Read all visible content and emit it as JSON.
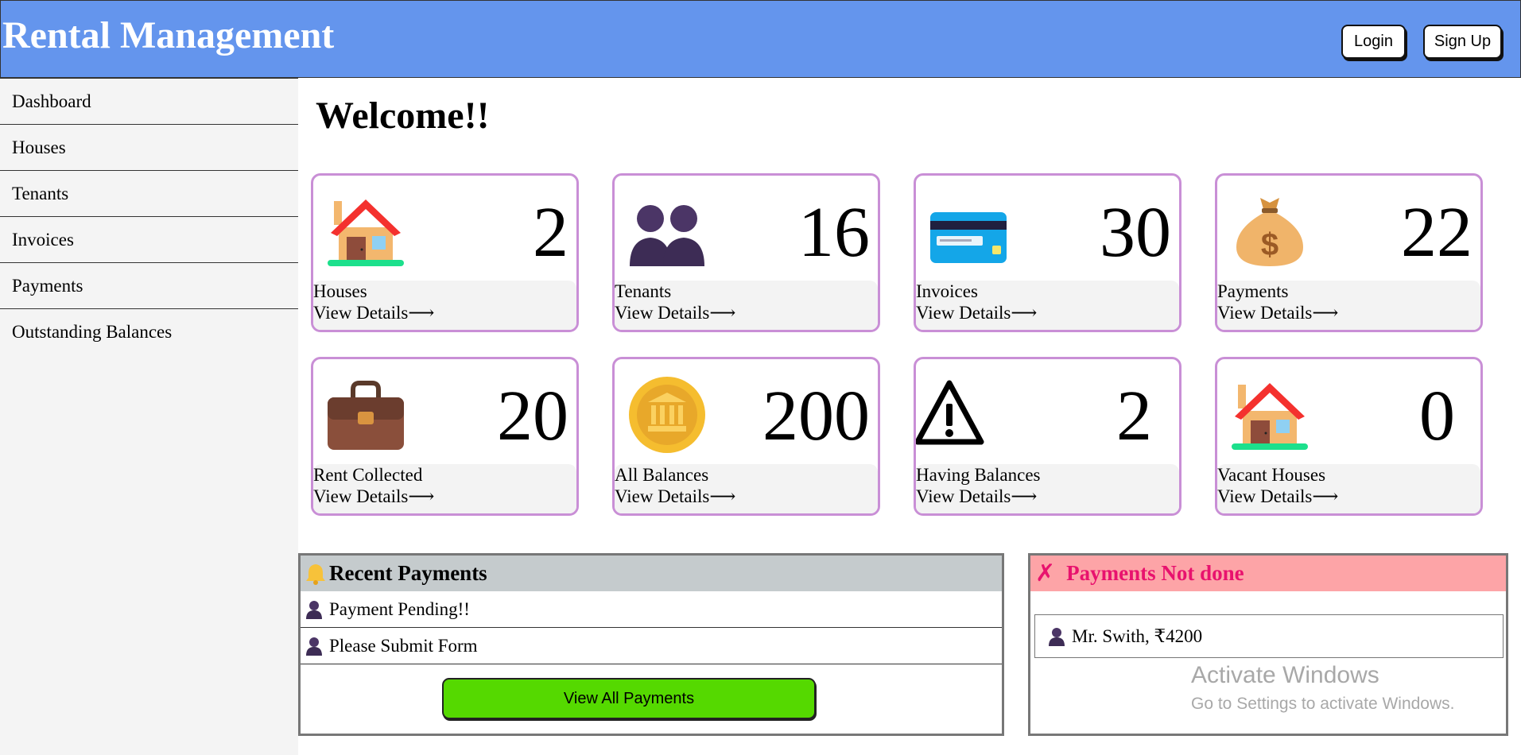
{
  "header": {
    "title": "Rental Management",
    "login_label": "Login",
    "signup_label": "Sign Up",
    "color": "#6495ed"
  },
  "sidebar": {
    "items": [
      {
        "label": "Dashboard"
      },
      {
        "label": "Houses"
      },
      {
        "label": "Tenants"
      },
      {
        "label": "Invoices"
      },
      {
        "label": "Payments"
      },
      {
        "label": "Outstanding Balances"
      }
    ]
  },
  "main": {
    "welcome": "Welcome!!",
    "cards": [
      {
        "label": "Houses",
        "count": "2",
        "link": "View Details⟶",
        "icon": "house-icon"
      },
      {
        "label": "Tenants",
        "count": "16",
        "link": "View Details⟶",
        "icon": "people-icon"
      },
      {
        "label": "Invoices",
        "count": "30",
        "link": "View Details⟶",
        "icon": "credit-card-icon"
      },
      {
        "label": "Payments",
        "count": "22",
        "link": "View Details⟶",
        "icon": "money-bag-icon"
      },
      {
        "label": "Rent Collected",
        "count": "20",
        "link": "View Details⟶",
        "icon": "briefcase-icon"
      },
      {
        "label": "All Balances",
        "count": "200",
        "link": "View Details⟶",
        "icon": "bank-coin-icon"
      },
      {
        "label": "Having Balances",
        "count": "2",
        "link": "View Details⟶",
        "icon": "warning-icon"
      },
      {
        "label": "Vacant Houses",
        "count": "0",
        "link": "View Details⟶",
        "icon": "house-icon"
      }
    ]
  },
  "recent_payments": {
    "title": "Recent Payments",
    "icon": "bell-icon",
    "rows": [
      "Payment Pending!!",
      "Please Submit Form"
    ],
    "button_label": "View All Payments"
  },
  "payments_not_done": {
    "title": "Payments Not done",
    "x_glyph": "✗",
    "rows": [
      "Mr. Swith, ₹4200"
    ]
  },
  "watermark": {
    "line1": "Activate Windows",
    "line2": "Go to Settings to activate Windows."
  }
}
